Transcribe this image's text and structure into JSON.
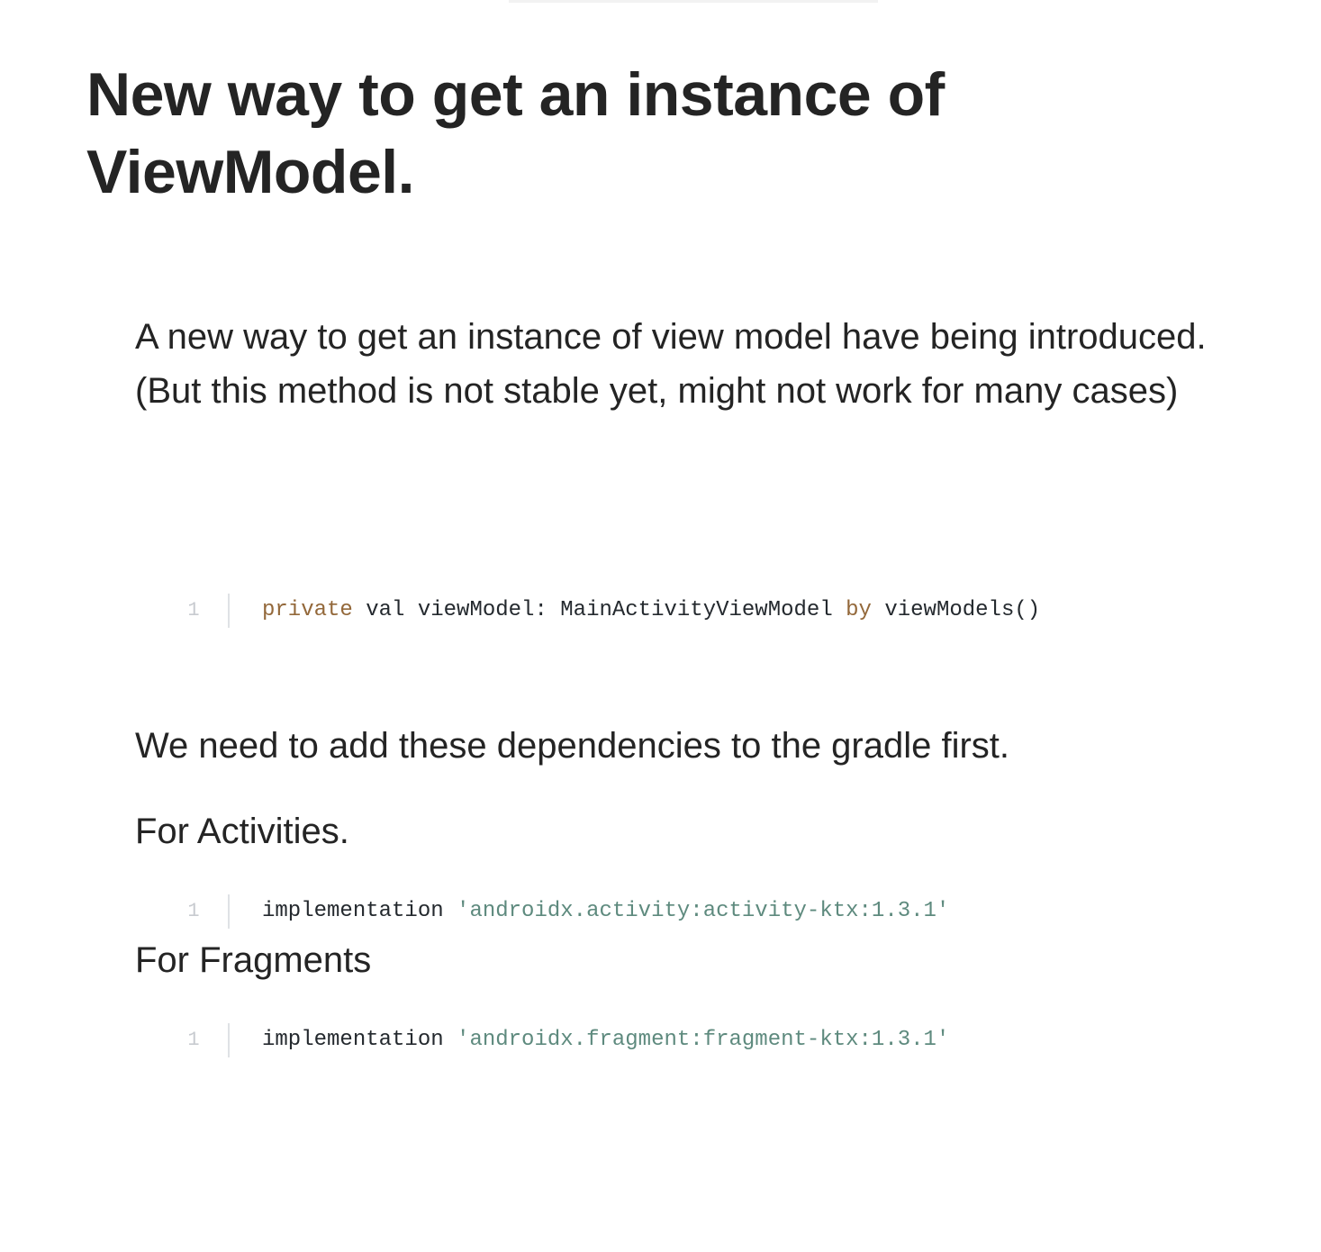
{
  "article": {
    "title": "New way to get an instance of ViewModel.",
    "intro": "A new way to get an instance of view model have being introduced. (But this method is not stable yet, might not work for many cases)",
    "dependencies_text": "We need to add these dependencies to the gradle first.",
    "activities_label": "For Activities.",
    "fragments_label": "For Fragments"
  },
  "gists": [
    {
      "line_number": "1",
      "tokens": {
        "kw1": "private",
        "t1": " val viewModel: MainActivityViewModel ",
        "kw2": "by",
        "t2": " viewModels()"
      }
    },
    {
      "line_number": "1",
      "tokens": {
        "t1": "implementation ",
        "str": "'androidx.activity:activity-ktx:1.3.1'"
      }
    },
    {
      "line_number": "1",
      "tokens": {
        "t1": "implementation ",
        "str": "'androidx.fragment:fragment-ktx:1.3.1'"
      }
    }
  ],
  "colors": {
    "text": "#242424",
    "keyword": "#93683a",
    "string": "#5e8a7e",
    "line_number": "#c8cbd0"
  }
}
